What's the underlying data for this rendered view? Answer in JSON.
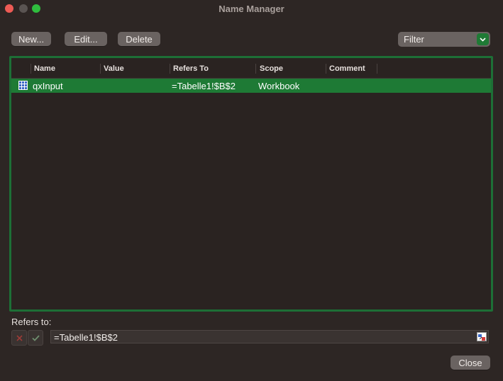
{
  "window": {
    "title": "Name Manager"
  },
  "toolbar": {
    "new_label": "New...",
    "edit_label": "Edit...",
    "delete_label": "Delete",
    "filter_label": "Filter"
  },
  "table": {
    "columns": [
      "Name",
      "Value",
      "Refers To",
      "Scope",
      "Comment"
    ],
    "rows": [
      {
        "name": "qxInput",
        "value": "",
        "refers_to": "=Tabelle1!$B$2",
        "scope": "Workbook",
        "comment": ""
      }
    ]
  },
  "refers": {
    "label": "Refers to:",
    "value": "=Tabelle1!$B$2"
  },
  "footer": {
    "close_label": "Close"
  },
  "colors": {
    "accent": "#1e7a35",
    "selection": "#1e7a35"
  }
}
